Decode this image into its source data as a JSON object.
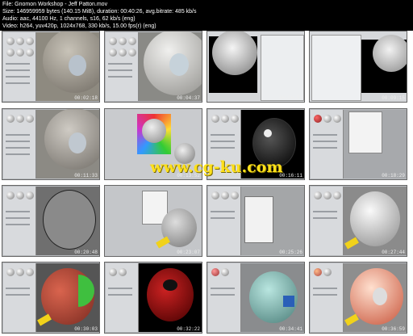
{
  "header": {
    "file": "File: Gnomon Workshop - Jeff Patton.mov",
    "size": "Size: 146959959 bytes (140.15 MiB), duration: 00:40:26, avg.bitrate: 485 kb/s",
    "audio": "Audio: aac, 44100 Hz, 1 channels, s16, 62 kb/s (eng)",
    "video": "Video: h264, yuv420p, 1024x768, 330 kb/s, 15.00 fps(r) (eng)"
  },
  "watermark": "www.cg-ku.com",
  "thumbnails": [
    {
      "time": "00:02:18"
    },
    {
      "time": "00:04:37"
    },
    {
      "time": "00:06:56"
    },
    {
      "time": "00:09:15"
    },
    {
      "time": "00:11:33"
    },
    {
      "time": "00:13:52"
    },
    {
      "time": "00:16:11"
    },
    {
      "time": "00:18:29"
    },
    {
      "time": "00:20:48"
    },
    {
      "time": "00:23:07"
    },
    {
      "time": "00:25:26"
    },
    {
      "time": "00:27:44"
    },
    {
      "time": "00:30:03"
    },
    {
      "time": "00:32:22"
    },
    {
      "time": "00:34:41"
    },
    {
      "time": "00:36:59"
    }
  ]
}
